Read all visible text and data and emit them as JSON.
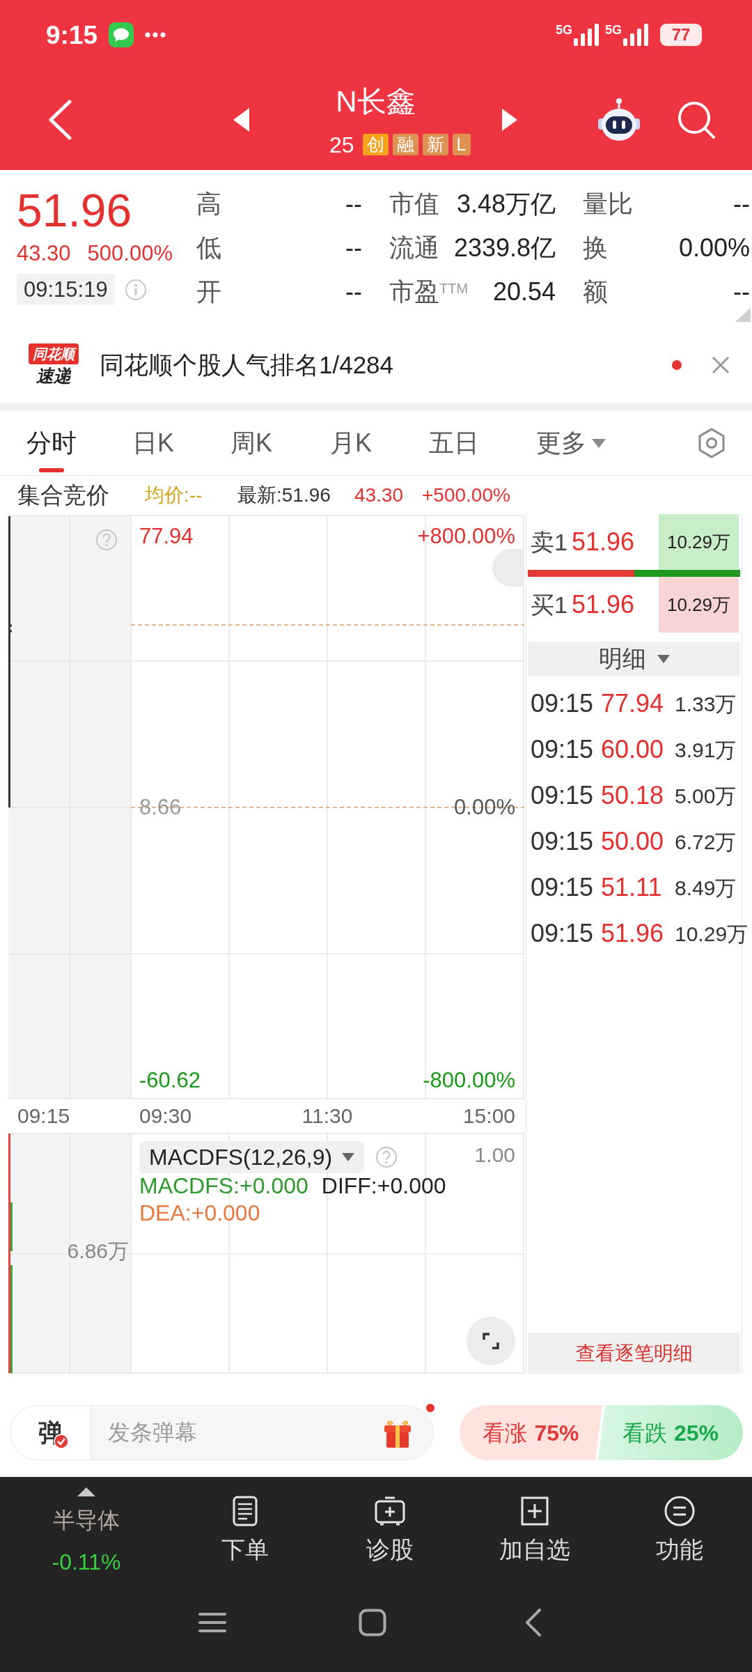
{
  "status_bar": {
    "time": "9:15",
    "networks": [
      {
        "label": "5G"
      },
      {
        "label": "5G"
      }
    ],
    "battery": "77"
  },
  "header": {
    "title": "N长鑫",
    "code": "25",
    "tags": [
      {
        "label": "创",
        "color": "#f5a31c"
      },
      {
        "label": "融",
        "color": "#de9150"
      },
      {
        "label": "新",
        "color": "#de9150"
      },
      {
        "label": "L",
        "color": "#de9150"
      }
    ]
  },
  "quote": {
    "price": "51.96",
    "change": "43.30",
    "change_percent": "500.00%",
    "time": "09:15:19",
    "stats": [
      {
        "label": "高",
        "value": "--"
      },
      {
        "label": "市值",
        "value": "3.48万亿"
      },
      {
        "label": "量比",
        "value": "--"
      },
      {
        "label": "低",
        "value": "--"
      },
      {
        "label": "流通",
        "value": "2339.8亿"
      },
      {
        "label": "换",
        "value": "0.00%"
      },
      {
        "label": "开",
        "value": "--"
      },
      {
        "label": "市盈$^{TTM}$",
        "value": "20.54"
      },
      {
        "label": "额",
        "value": "--"
      }
    ]
  },
  "banner": {
    "logo_title": "同花顺",
    "logo_subtitle": "速递",
    "headline": "同花顺个股人气排名1/4284",
    "unread": true
  },
  "tabs": [
    {
      "label": "分时",
      "selected": true,
      "dropdown": false
    },
    {
      "label": "日K",
      "selected": false,
      "dropdown": false
    },
    {
      "label": "周K",
      "selected": false,
      "dropdown": false
    },
    {
      "label": "月K",
      "selected": false,
      "dropdown": false
    },
    {
      "label": "五日",
      "selected": false,
      "dropdown": false
    },
    {
      "label": "更多",
      "selected": false,
      "dropdown": true
    }
  ],
  "chart_header": {
    "title": "集合竞价",
    "average": "均价:--",
    "latest": "最新:51.96",
    "change": "43.30",
    "change_percent": "+500.00%"
  },
  "price_chart": {
    "y_axis": [
      {
        "price": "77.94",
        "percent": "+800.00%",
        "kind": "up"
      },
      {
        "price": "8.66",
        "percent": "0.00%",
        "kind": "flat"
      },
      {
        "price": "-60.62",
        "percent": "-800.00%",
        "kind": "down"
      }
    ],
    "x_axis": [
      "09:15",
      "09:30",
      "11:30",
      "15:00"
    ]
  },
  "indicator": {
    "name": "MACDFS(12,26,9)",
    "max": "1.00",
    "volume": "6.86万",
    "lines": [
      {
        "text": "MACDFS:+0.000",
        "color": "#2e9a2e"
      },
      {
        "text": "DIFF:+0.000",
        "color": "#222222"
      },
      {
        "text": "DEA:+0.000",
        "color": "#e8783c"
      }
    ]
  },
  "order_book": {
    "ask": {
      "label": "卖1",
      "price": "51.96",
      "volume": "10.29万"
    },
    "bid": {
      "label": "买1",
      "price": "51.96",
      "volume": "10.29万"
    },
    "balance": {
      "level": 0.5
    }
  },
  "trades": {
    "title": "明细",
    "rows": [
      {
        "time": "09:15",
        "price": "77.94",
        "volume": "1.33万"
      },
      {
        "time": "09:15",
        "price": "60.00",
        "volume": "3.91万"
      },
      {
        "time": "09:15",
        "price": "50.18",
        "volume": "5.00万"
      },
      {
        "time": "09:15",
        "price": "50.00",
        "volume": "6.72万"
      },
      {
        "time": "09:15",
        "price": "51.11",
        "volume": "8.49万"
      },
      {
        "time": "09:15",
        "price": "51.96",
        "volume": "10.29万"
      }
    ],
    "more_button": "查看逐笔明细"
  },
  "danmaku": {
    "badge": "弹",
    "placeholder": "发条弹幕",
    "new": true
  },
  "vote": [
    {
      "label": "看涨",
      "value": "75%",
      "kind": "bull"
    },
    {
      "label": "看跌",
      "value": "25%",
      "kind": "bear"
    }
  ],
  "bottom_nav": {
    "sector": {
      "name": "半导体",
      "change": "-0.11%"
    },
    "items": [
      {
        "label": "下单"
      },
      {
        "label": "诊股"
      },
      {
        "label": "加自选"
      },
      {
        "label": "功能"
      }
    ]
  }
}
